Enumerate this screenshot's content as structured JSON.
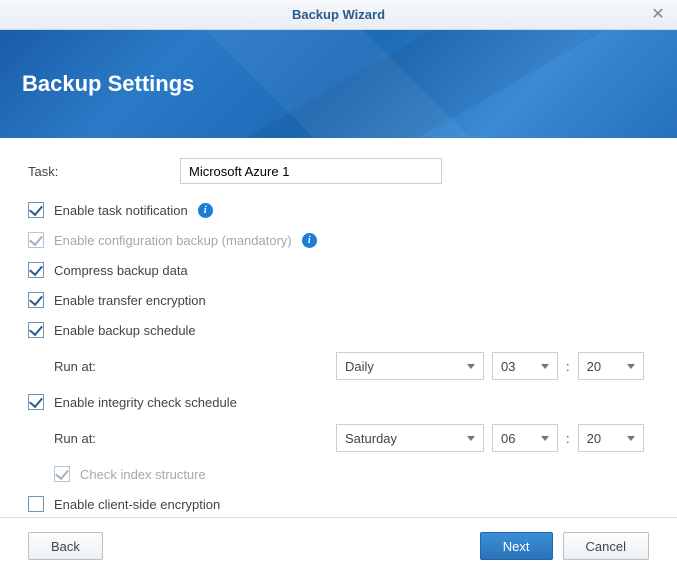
{
  "window": {
    "title": "Backup Wizard"
  },
  "header": {
    "title": "Backup Settings"
  },
  "form": {
    "task_label": "Task:",
    "task_value": "Microsoft Azure 1",
    "enable_notification": "Enable task notification",
    "enable_config_backup": "Enable configuration backup (mandatory)",
    "compress": "Compress backup data",
    "transfer_encryption": "Enable transfer encryption",
    "backup_schedule": "Enable backup schedule",
    "run_at": "Run at:",
    "schedule1_freq": "Daily",
    "schedule1_hour": "03",
    "schedule1_min": "20",
    "integrity_check": "Enable integrity check schedule",
    "schedule2_freq": "Saturday",
    "schedule2_hour": "06",
    "schedule2_min": "20",
    "check_index": "Check index structure",
    "client_encryption": "Enable client-side encryption"
  },
  "footer": {
    "back": "Back",
    "next": "Next",
    "cancel": "Cancel"
  }
}
